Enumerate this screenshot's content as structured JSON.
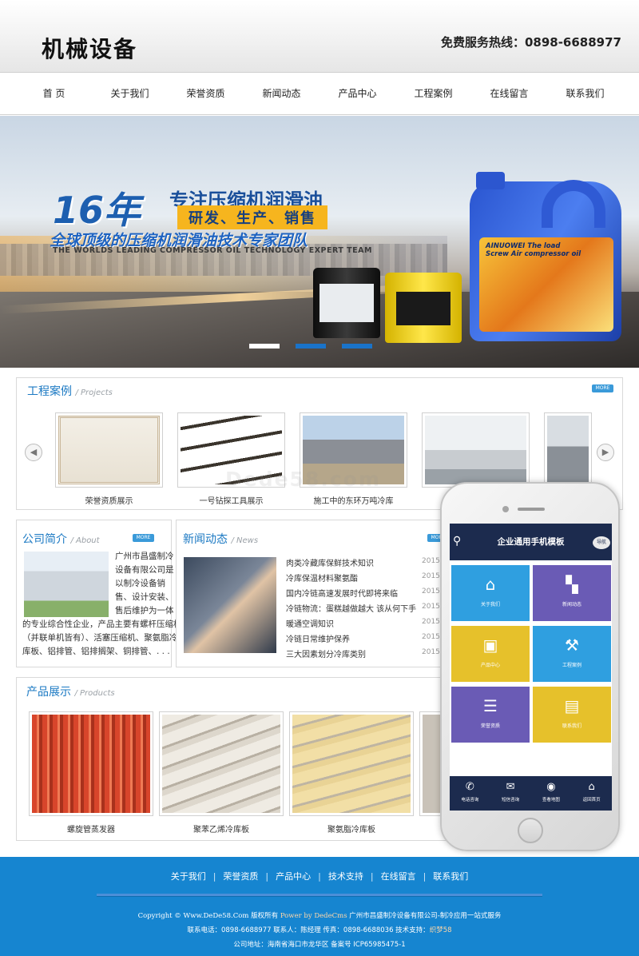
{
  "header": {
    "site_title": "机械设备",
    "hotline": "免费服务热线：0898-6688977"
  },
  "nav": {
    "items": [
      "首 页",
      "关于我们",
      "荣誉资质",
      "新闻动态",
      "产品中心",
      "工程案例",
      "在线留言",
      "联系我们"
    ]
  },
  "banner": {
    "headline": "16年",
    "title": "专注压缩机润滑油",
    "subtitle": "研发、生产、销售",
    "slogan": "全球顶级的压缩机润滑油技术专家团队",
    "slogan_en": "THE WORLDS LEADING COMPRESSOR OIL TECHNOLOGY EXPERT TEAM",
    "jug_label_1": "AINUOWEI The load",
    "jug_label_2": "Screw Air compressor oil",
    "slide_count": 3,
    "active_slide": 2,
    "dot_colors": [
      "#ffffff",
      "#1a73c9",
      "#1a73c9"
    ]
  },
  "projects": {
    "title": "工程案例",
    "subtitle": "/ Projects",
    "more": "MORE",
    "prev_icon": "chevron-left-icon",
    "next_icon": "chevron-right-icon",
    "items": [
      {
        "caption": "荣誉资质展示"
      },
      {
        "caption": "一号钻探工具展示"
      },
      {
        "caption": "施工中的东环万吨冷库"
      },
      {
        "caption": ""
      },
      {
        "caption": ""
      }
    ]
  },
  "about": {
    "title": "公司简介",
    "subtitle": "/ About",
    "more": "MORE",
    "lines": [
      "广州市昌盛制冷",
      "设备有限公司是",
      "以制冷设备销",
      "售、设计安装、",
      "售后维护为一体"
    ],
    "lines_full": [
      "的专业综合性企业，产品主要有螺杆压缩机",
      "（并联单机皆有）、活塞压缩机、聚氨脂冷",
      "库板、铝排管、铝排搁架、铜排管、. . ."
    ]
  },
  "news": {
    "title": "新闻动态",
    "subtitle": "/ News",
    "more": "MORE",
    "items": [
      {
        "title": "肉类冷藏库保鲜技术知识",
        "date": "2015-"
      },
      {
        "title": "冷库保温材料聚氨酯",
        "date": "2015-"
      },
      {
        "title": "国内冷链高速发展时代即将来临",
        "date": "2015-"
      },
      {
        "title": "冷链物流：蛋糕越做越大 该从何下手",
        "date": "2015-"
      },
      {
        "title": "暖通空调知识",
        "date": "2015-"
      },
      {
        "title": "冷链日常维护保养",
        "date": "2015-"
      },
      {
        "title": "三大因素划分冷库类别",
        "date": "2015-"
      }
    ]
  },
  "products": {
    "title": "产品展示",
    "subtitle": "/ Products",
    "items": [
      {
        "caption": "螺旋管蒸发器"
      },
      {
        "caption": "聚苯乙烯冷库板"
      },
      {
        "caption": "聚氨脂冷库板"
      },
      {
        "caption": ""
      }
    ]
  },
  "mobile": {
    "title": "企业通用手机模板",
    "nav_label": "导航",
    "search_icon": "search-icon",
    "tiles": [
      {
        "label": "关于我们",
        "icon": "home-icon",
        "color": "#2f9fe0"
      },
      {
        "label": "新闻动态",
        "icon": "grid-icon",
        "color": "#6a5bb5"
      },
      {
        "label": "产品中心",
        "icon": "bag-icon",
        "color": "#e6c12b"
      },
      {
        "label": "工程案例",
        "icon": "gavel-icon",
        "color": "#2f9fe0"
      },
      {
        "label": "荣誉资质",
        "icon": "document-icon",
        "color": "#6a5bb5"
      },
      {
        "label": "联系我们",
        "icon": "notebook-icon",
        "color": "#e6c12b"
      }
    ],
    "bottom_bar": [
      {
        "label": "电话咨询",
        "icon": "phone-icon"
      },
      {
        "label": "短信咨询",
        "icon": "envelope-icon"
      },
      {
        "label": "查看地图",
        "icon": "map-pin-icon"
      },
      {
        "label": "返回首页",
        "icon": "home-icon"
      }
    ]
  },
  "watermark": "Dede58.com",
  "footer": {
    "nav": [
      "关于我们",
      "荣誉资质",
      "产品中心",
      "技术支持",
      "在线留言",
      "联系我们"
    ],
    "separator": "|",
    "copyright_prefix": "Copyright © Www.DeDe58.Com",
    "copyright_mid": "版权所有",
    "powered": "Power by DedeCms",
    "company": "广州市昌盛制冷设备有限公司-制冷应用一站式服务",
    "contact_prefix": "联系电话：0898-6688977 联系人：陈经理 传真：0898-6688036 技术支持：",
    "support_link": "织梦58",
    "address": "公司地址：海南省海口市龙华区 备案号 ICP65985475-1"
  },
  "colors": {
    "accent": "#1b79c3",
    "footer_bg": "#1685d0",
    "mobile_header": "#1c2b4e"
  }
}
